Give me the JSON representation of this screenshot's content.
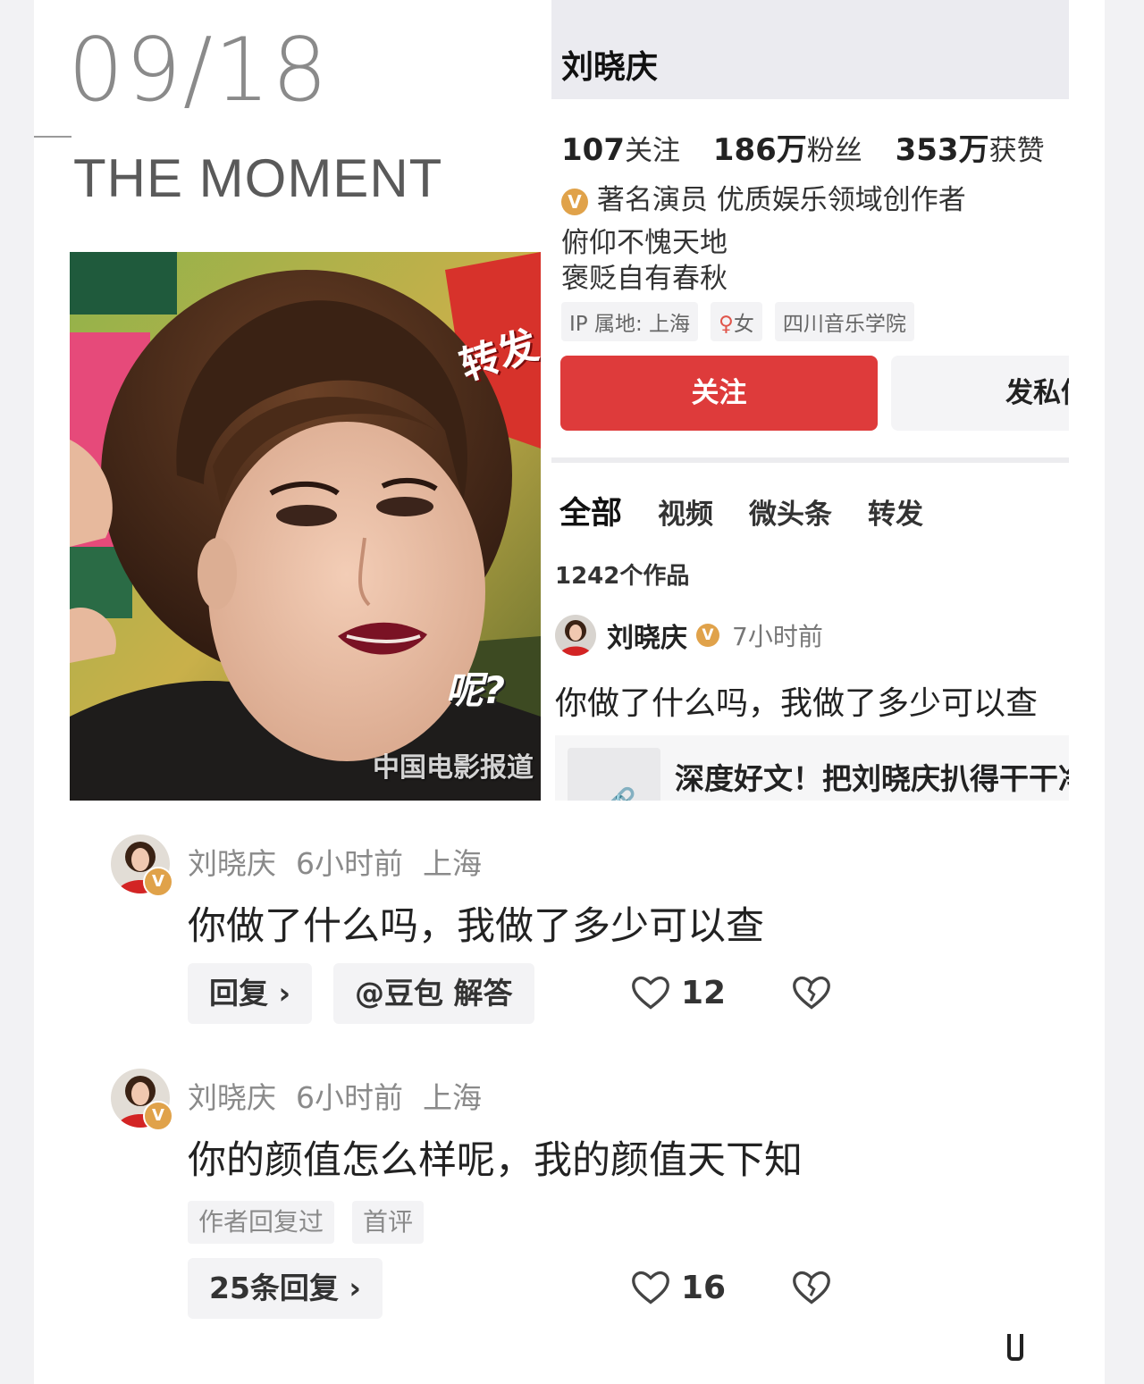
{
  "header": {
    "date": "09/18",
    "subtitle": "THE MOMENT"
  },
  "photo": {
    "watermark": "中国电影报道",
    "sign_text": "呢?",
    "burst_text": "转发"
  },
  "profile": {
    "name": "刘晓庆",
    "stats": [
      {
        "value": "107",
        "label": "关注"
      },
      {
        "value": "186万",
        "label": "粉丝"
      },
      {
        "value": "353万",
        "label": "获赞"
      }
    ],
    "verified_badge": "V",
    "certification": "著名演员 优质娱乐领域创作者",
    "bio_lines": [
      "俯仰不愧天地",
      "褒贬自有春秋"
    ],
    "tags": [
      "IP 属地: 上海",
      "女",
      "四川音乐学院"
    ],
    "gender_symbol": "♀",
    "follow_label": "关注",
    "message_label": "发私信",
    "tabs": [
      "全部",
      "视频",
      "微头条",
      "转发"
    ],
    "works_count": "1242个作品",
    "post": {
      "author": "刘晓庆",
      "time": "7小时前",
      "text": "你做了什么吗，我做了多少可以查",
      "link_title": "深度好文！把刘晓庆扒得干干净净"
    }
  },
  "comments": [
    {
      "author": "刘晓庆",
      "time": "6小时前",
      "location": "上海",
      "text": "你做了什么吗，我做了多少可以查",
      "reply_label": "回复 ›",
      "ai_label": "@豆包 解答",
      "likes": "12"
    },
    {
      "author": "刘晓庆",
      "time": "6小时前",
      "location": "上海",
      "text": "你的颜值怎么样呢，我的颜值天下知",
      "tags": [
        "作者回复过",
        "首评"
      ],
      "replies_label": "25条回复 ›",
      "likes": "16"
    }
  ],
  "colors": {
    "accent": "#de3b3b",
    "badge": "#e0a24a"
  }
}
